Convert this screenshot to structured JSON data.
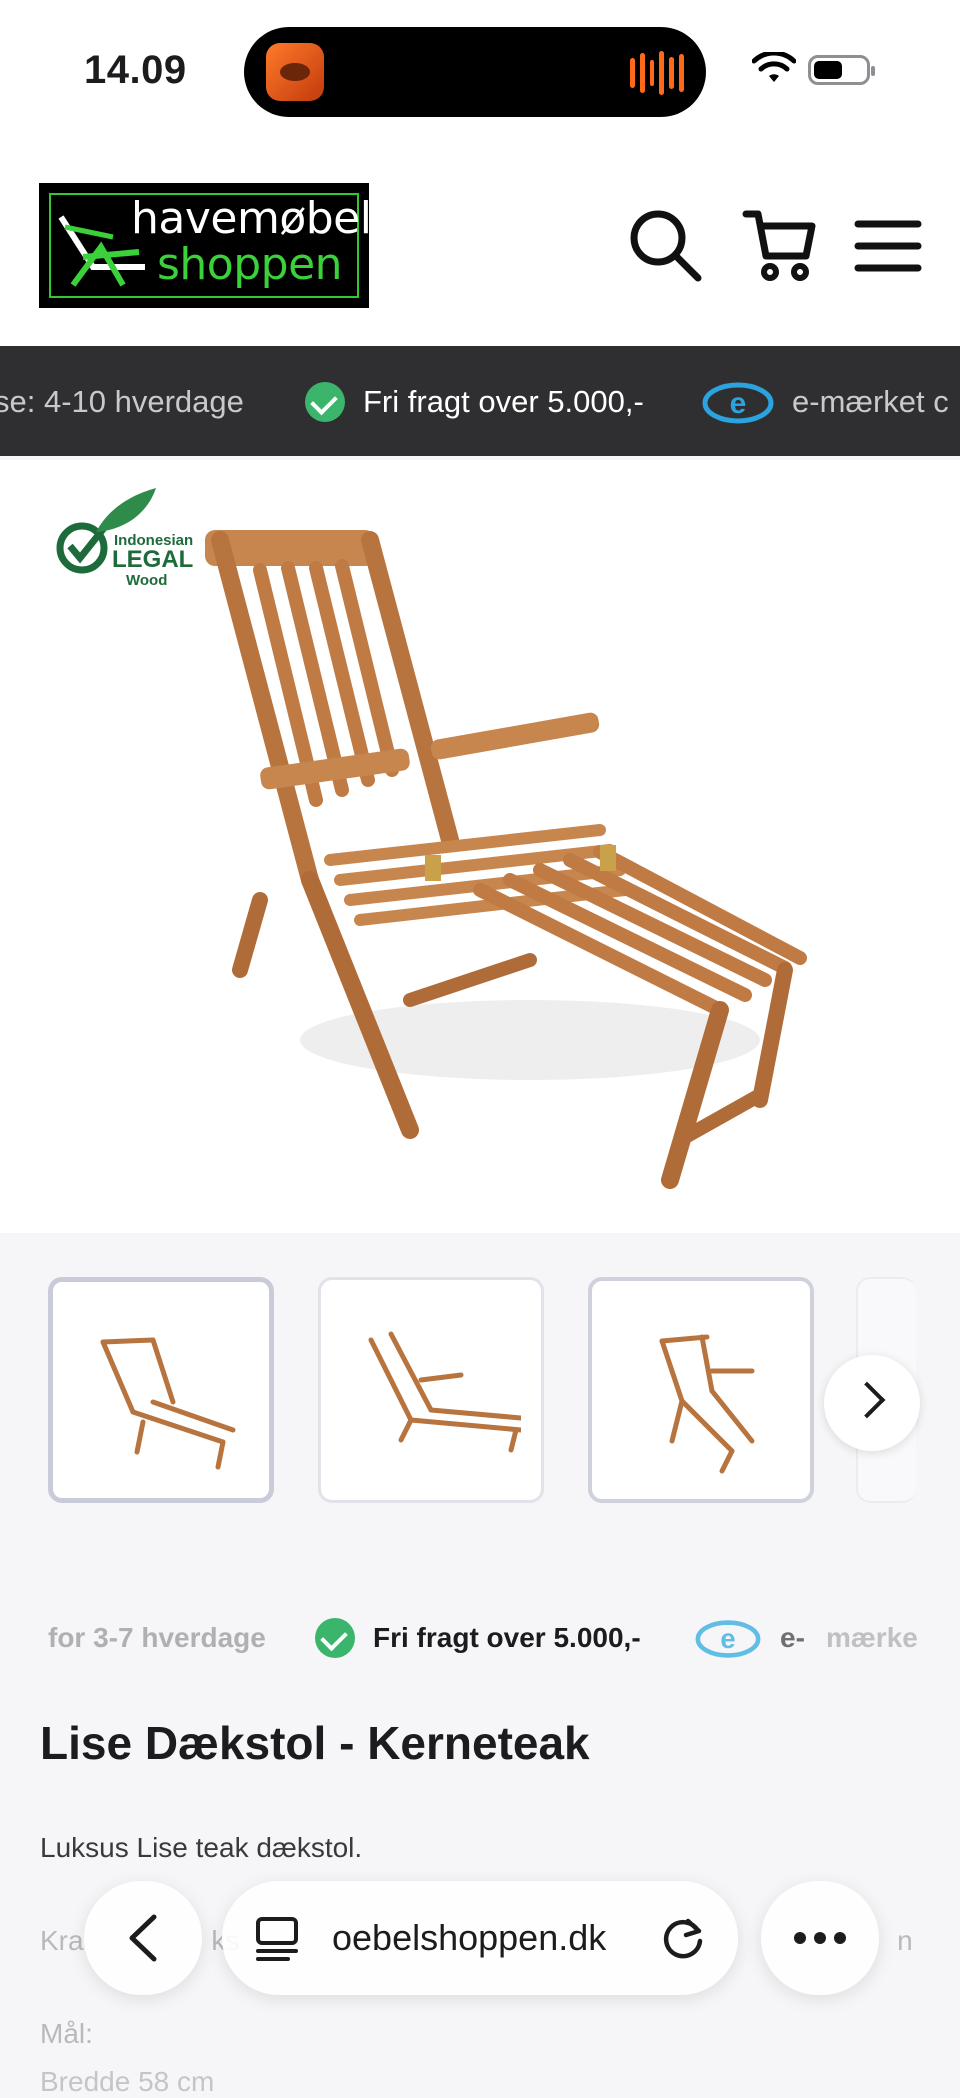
{
  "status": {
    "time": "14.09"
  },
  "header": {
    "logo_line1": "havemøbel",
    "logo_line2": "shoppen"
  },
  "usp_ticker": [
    {
      "text": "se: 4-10 hverdage"
    },
    {
      "text": "Fri fragt over 5.000,-"
    },
    {
      "text": "e-mærket c"
    }
  ],
  "badge": {
    "line1": "Indonesian",
    "line2": "LEGAL",
    "line3": "Wood"
  },
  "usp_strip": [
    {
      "text": "for 3-7 hverdage"
    },
    {
      "text": "Fri fragt over 5.000,-"
    },
    {
      "text": "e-"
    },
    {
      "text": "mærke"
    }
  ],
  "product": {
    "title": "Lise Dækstol - Kerneteak",
    "description": "Luksus Lise teak dækstol.",
    "line2_start": "Kra",
    "line2_mid": "ks",
    "line2_end": "n",
    "dims_label": "Mål:",
    "dims_partial": "Bredde 58 cm"
  },
  "browser": {
    "url": "oebelshoppen.dk"
  },
  "colors": {
    "ticker_bg": "#2f2f31",
    "check_green": "#3bb56b",
    "emark_blue": "#2ba3df",
    "logo_green": "#3ad13a"
  }
}
